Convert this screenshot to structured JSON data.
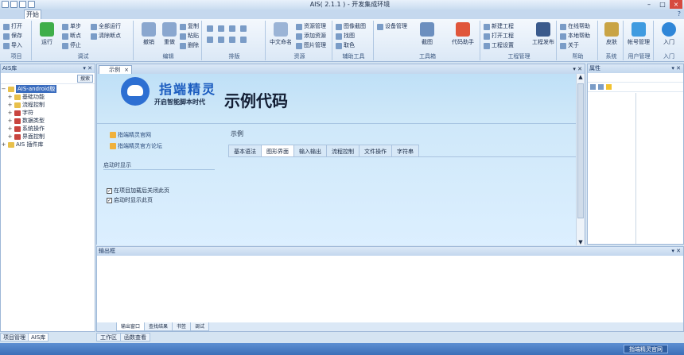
{
  "window": {
    "title": "AIS( 2.1.1 ) - 开发集成环境"
  },
  "ribbon": {
    "tab_label": "开始",
    "help": "?",
    "groups": [
      {
        "label": "项目",
        "buttons": [
          "打开",
          "保存",
          "导入"
        ]
      },
      {
        "label": "调试",
        "buttons": [
          "运行",
          "单步",
          "断点",
          "停止",
          "全部运行",
          "清除断点"
        ]
      },
      {
        "label": "编辑",
        "buttons": [
          "撤销",
          "重做",
          "复制",
          "粘贴",
          "删除"
        ]
      },
      {
        "label": "排版",
        "buttons": []
      },
      {
        "label": "资源",
        "buttons": [
          "中文命名",
          "资源管理",
          "添加资源",
          "图片管理"
        ]
      },
      {
        "label": "辅助工具",
        "buttons": [
          "图像截图",
          "找图",
          "取色"
        ]
      },
      {
        "label": "工具箱",
        "buttons": [
          "设备管理",
          "截图",
          "代码助手"
        ]
      },
      {
        "label": "工程管理",
        "buttons": [
          "新建工程",
          "打开工程",
          "工程设置",
          "工程发布"
        ]
      },
      {
        "label": "帮助",
        "buttons": [
          "在线帮助",
          "本地帮助",
          "关于"
        ]
      },
      {
        "label": "系统",
        "buttons": [
          "皮肤"
        ]
      },
      {
        "label": "用户管理",
        "buttons": [
          "帐号管理"
        ]
      },
      {
        "label": "入门",
        "buttons": [
          "入门"
        ]
      }
    ]
  },
  "left_panel": {
    "title": "AIS库",
    "search_button": "搜索",
    "tree": [
      {
        "label": "AIS-android版",
        "level": 0,
        "selected": true
      },
      {
        "label": "基础功能",
        "level": 1
      },
      {
        "label": "流程控制",
        "level": 1
      },
      {
        "label": "字符",
        "level": 1
      },
      {
        "label": "数据类型",
        "level": 1
      },
      {
        "label": "系统操作",
        "level": 1
      },
      {
        "label": "界面控制",
        "level": 1
      },
      {
        "label": "AIS 插件库",
        "level": 0
      }
    ],
    "bottom_tabs": [
      "项目管理",
      "AIS库"
    ]
  },
  "document": {
    "tab_label": "示例",
    "brand": "指端精灵",
    "slogan": "开启智能脚本时代",
    "big_title": "示例代码",
    "links": [
      "指端精灵官网",
      "指端精灵官方论坛"
    ],
    "section_title": "启动时显示",
    "checkboxes": [
      {
        "label": "在项目加载后关闭此页",
        "checked": true
      },
      {
        "label": "启动时显示此页",
        "checked": true
      }
    ],
    "example_label": "示例",
    "example_tabs": [
      "基本语法",
      "图形界面",
      "输入输出",
      "流程控制",
      "文件操作",
      "字符串"
    ]
  },
  "right_panel": {
    "title": "属性"
  },
  "output_panel": {
    "title": "输出框",
    "tabs": [
      "输出窗口",
      "查找结果",
      "书签",
      "调试"
    ]
  },
  "bottom_bar": {
    "tabs": [
      "工作区",
      "函数查看"
    ]
  },
  "status": {
    "right_text": "指端精灵官网"
  }
}
